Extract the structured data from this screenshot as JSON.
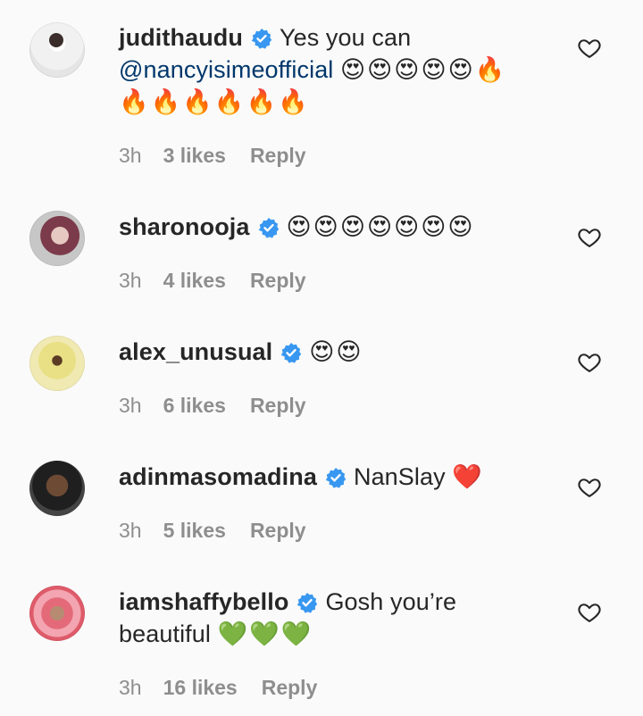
{
  "comments": [
    {
      "username": "judithaudu",
      "text_line1": "Yes you can",
      "mention": "@nancyisimeofficial",
      "emojis_line1": "😍😍😍😍😍🔥",
      "emojis_line2": "🔥🔥🔥🔥🔥🔥",
      "time": "3h",
      "likes": "3 likes",
      "reply": "Reply"
    },
    {
      "username": "sharonooja",
      "emojis": "😍😍😍😍😍😍😍",
      "time": "3h",
      "likes": "4 likes",
      "reply": "Reply"
    },
    {
      "username": "alex_unusual",
      "emojis": "😍😍",
      "time": "3h",
      "likes": "6 likes",
      "reply": "Reply"
    },
    {
      "username": "adinmasomadina",
      "text": "NanSlay",
      "emojis": "❤️",
      "time": "3h",
      "likes": "5 likes",
      "reply": "Reply"
    },
    {
      "username": "iamshaffybello",
      "text_line1": "Gosh you’re",
      "text_line2": "beautiful",
      "emojis": "💚💚💚",
      "time": "3h",
      "likes": "16 likes",
      "reply": "Reply"
    }
  ],
  "colors": {
    "verified": "#3897f0",
    "mention": "#00376b",
    "meta": "#8e8e8e"
  },
  "icons": {
    "verified": "verified-badge-icon",
    "like": "heart-outline-icon"
  }
}
